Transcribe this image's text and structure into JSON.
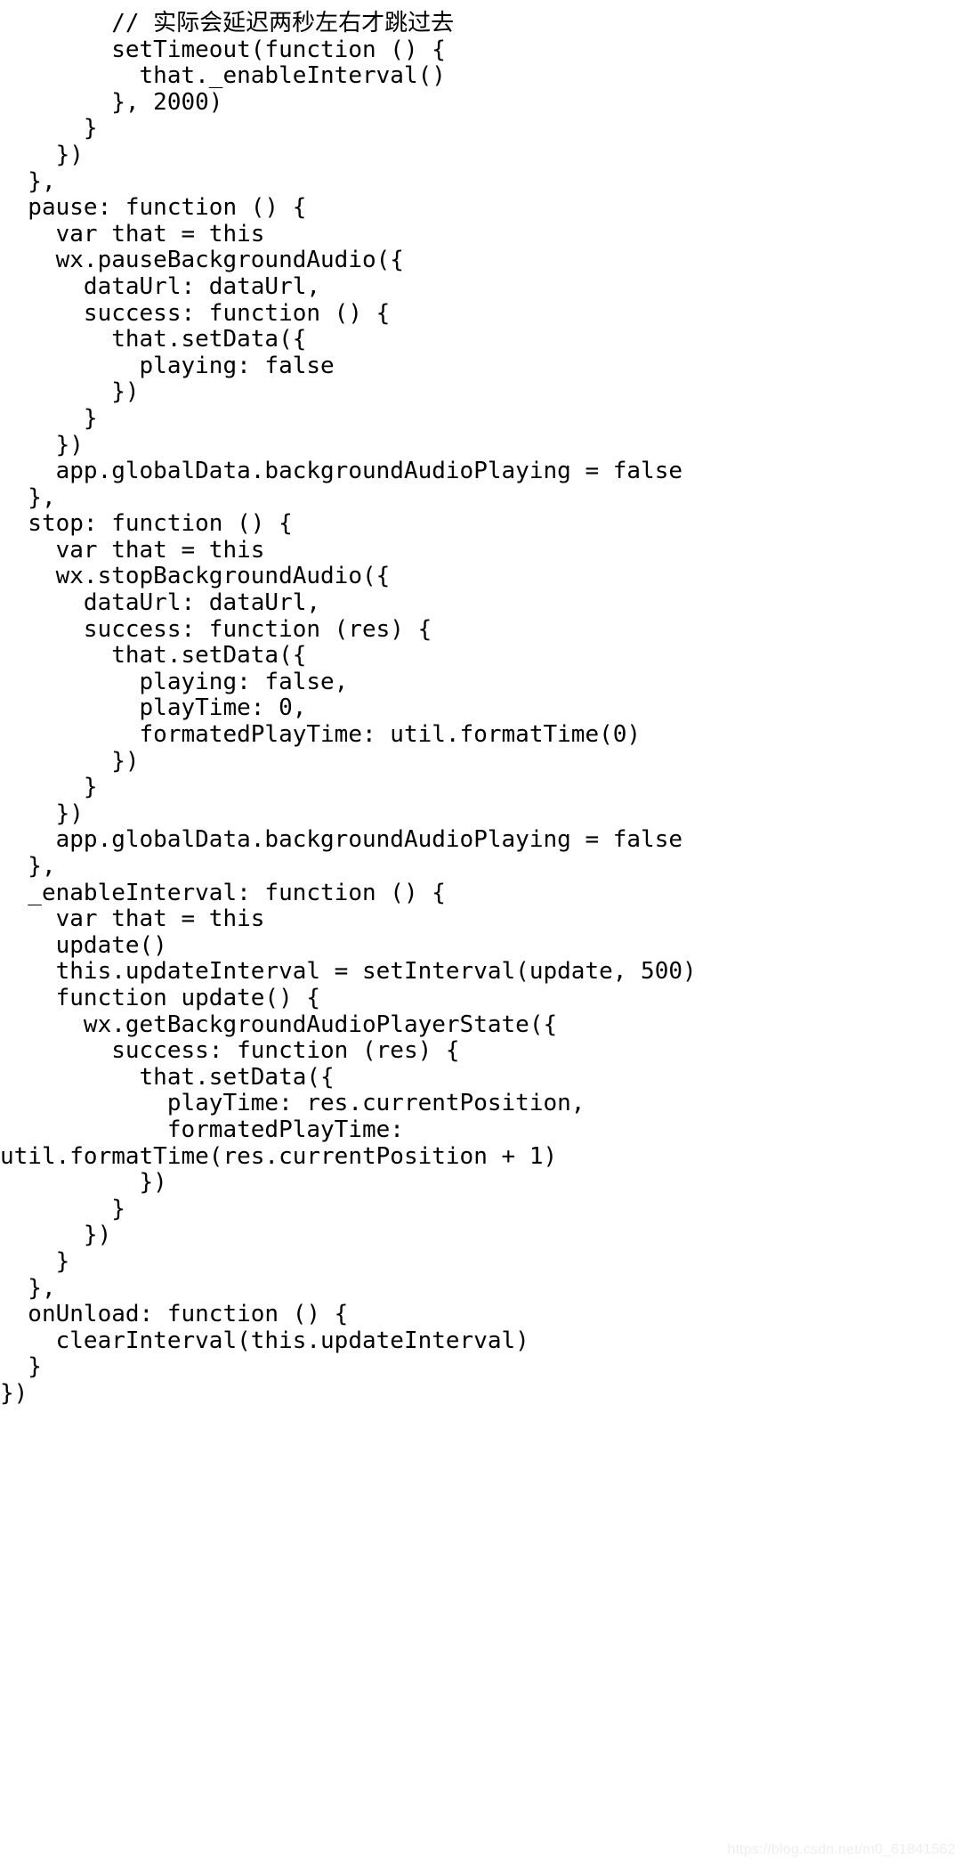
{
  "document": {
    "kind": "code-screenshot",
    "language": "javascript",
    "background_color": "#ffffff",
    "text_color": "#000000",
    "watermark": {
      "text": "https://blog.csdn.net/m0_61841562",
      "color": "#eeeeee"
    }
  },
  "code": {
    "lines": [
      "        // 实际会延迟两秒左右才跳过去",
      "        setTimeout(function () {",
      "          that._enableInterval()",
      "        }, 2000)",
      "      }",
      "    })",
      "  },",
      "  pause: function () {",
      "    var that = this",
      "    wx.pauseBackgroundAudio({",
      "      dataUrl: dataUrl,",
      "      success: function () {",
      "        that.setData({",
      "          playing: false",
      "        })",
      "      }",
      "    })",
      "    app.globalData.backgroundAudioPlaying = false",
      "  },",
      "  stop: function () {",
      "    var that = this",
      "    wx.stopBackgroundAudio({",
      "      dataUrl: dataUrl,",
      "      success: function (res) {",
      "        that.setData({",
      "          playing: false,",
      "          playTime: 0,",
      "          formatedPlayTime: util.formatTime(0)",
      "        })",
      "      }",
      "    })",
      "    app.globalData.backgroundAudioPlaying = false",
      "  },",
      "  _enableInterval: function () {",
      "    var that = this",
      "    update()",
      "    this.updateInterval = setInterval(update, 500)",
      "    function update() {",
      "      wx.getBackgroundAudioPlayerState({",
      "        success: function (res) {",
      "          that.setData({",
      "            playTime: res.currentPosition,",
      "            formatedPlayTime:",
      "util.formatTime(res.currentPosition + 1)",
      "          })",
      "        }",
      "      })",
      "    }",
      "  },",
      "  onUnload: function () {",
      "    clearInterval(this.updateInterval)",
      "  }",
      "})"
    ]
  }
}
